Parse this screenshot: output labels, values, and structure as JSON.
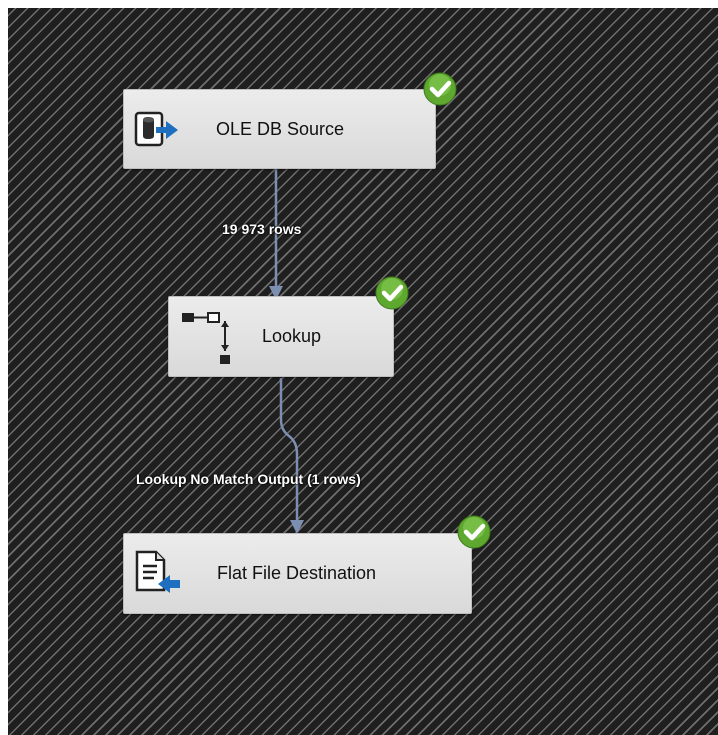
{
  "components": {
    "ole_db_source": {
      "label": "OLE DB Source",
      "icon": "database-source-icon",
      "status": "success"
    },
    "lookup": {
      "label": "Lookup",
      "icon": "lookup-icon",
      "status": "success"
    },
    "flat_file_destination": {
      "label": "Flat File Destination",
      "icon": "flat-file-destination-icon",
      "status": "success"
    }
  },
  "paths": {
    "source_to_lookup": {
      "label": "19 973 rows"
    },
    "lookup_to_destination": {
      "label": "Lookup No Match Output (1 rows)"
    }
  },
  "colors": {
    "path": "#7d8fb0",
    "status_success": "#5ea82f",
    "arrow_blue": "#1f6fc1"
  }
}
